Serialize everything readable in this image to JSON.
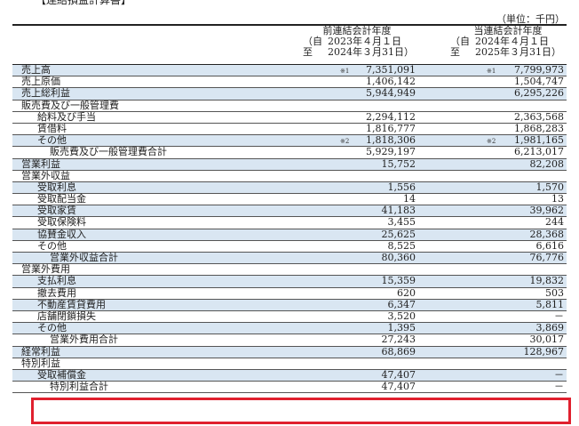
{
  "doc_title": "【連結損益計算書】",
  "unit": "（単位：千円）",
  "columns": {
    "prev": {
      "title": "前連結会計年度",
      "from_k": "（自",
      "from": "2023年４月１日",
      "to_k": "至",
      "to": "2024年３月31日）"
    },
    "cur": {
      "title": "当連結会計年度",
      "from_k": "（自",
      "from": "2024年４月１日",
      "to_k": "至",
      "to": "2025年３月31日）"
    }
  },
  "rows": [
    {
      "label": "売上高",
      "indent": 0,
      "shade": true,
      "note_prev": "※1",
      "prev": "7,351,091",
      "note_cur": "※1",
      "cur": "7,799,973"
    },
    {
      "label": "売上原価",
      "indent": 0,
      "shade": false,
      "note_prev": "",
      "prev": "1,406,142",
      "note_cur": "",
      "cur": "1,504,747"
    },
    {
      "label": "売上総利益",
      "indent": 0,
      "shade": true,
      "note_prev": "",
      "prev": "5,944,949",
      "note_cur": "",
      "cur": "6,295,226"
    },
    {
      "label": "販売費及び一般管理費",
      "indent": 0,
      "shade": false,
      "note_prev": "",
      "prev": "",
      "note_cur": "",
      "cur": ""
    },
    {
      "label": "給料及び手当",
      "indent": 1,
      "shade": false,
      "note_prev": "",
      "prev": "2,294,112",
      "note_cur": "",
      "cur": "2,363,568"
    },
    {
      "label": "賃借料",
      "indent": 1,
      "shade": false,
      "note_prev": "",
      "prev": "1,816,777",
      "note_cur": "",
      "cur": "1,868,283"
    },
    {
      "label": "その他",
      "indent": 1,
      "shade": true,
      "note_prev": "※2",
      "prev": "1,818,306",
      "note_cur": "※2",
      "cur": "1,981,165"
    },
    {
      "label": "販売費及び一般管理費合計",
      "indent": 2,
      "shade": false,
      "note_prev": "",
      "prev": "5,929,197",
      "note_cur": "",
      "cur": "6,213,017"
    },
    {
      "label": "営業利益",
      "indent": 0,
      "shade": true,
      "note_prev": "",
      "prev": "15,752",
      "note_cur": "",
      "cur": "82,208"
    },
    {
      "label": "営業外収益",
      "indent": 0,
      "shade": false,
      "note_prev": "",
      "prev": "",
      "note_cur": "",
      "cur": ""
    },
    {
      "label": "受取利息",
      "indent": 1,
      "shade": true,
      "note_prev": "",
      "prev": "1,556",
      "note_cur": "",
      "cur": "1,570"
    },
    {
      "label": "受取配当金",
      "indent": 1,
      "shade": false,
      "note_prev": "",
      "prev": "14",
      "note_cur": "",
      "cur": "13"
    },
    {
      "label": "受取家賃",
      "indent": 1,
      "shade": true,
      "note_prev": "",
      "prev": "41,183",
      "note_cur": "",
      "cur": "39,962"
    },
    {
      "label": "受取保険料",
      "indent": 1,
      "shade": false,
      "note_prev": "",
      "prev": "3,455",
      "note_cur": "",
      "cur": "244"
    },
    {
      "label": "協賛金収入",
      "indent": 1,
      "shade": true,
      "note_prev": "",
      "prev": "25,625",
      "note_cur": "",
      "cur": "28,368"
    },
    {
      "label": "その他",
      "indent": 1,
      "shade": false,
      "note_prev": "",
      "prev": "8,525",
      "note_cur": "",
      "cur": "6,616"
    },
    {
      "label": "営業外収益合計",
      "indent": 2,
      "shade": true,
      "note_prev": "",
      "prev": "80,360",
      "note_cur": "",
      "cur": "76,776"
    },
    {
      "label": "営業外費用",
      "indent": 0,
      "shade": false,
      "note_prev": "",
      "prev": "",
      "note_cur": "",
      "cur": ""
    },
    {
      "label": "支払利息",
      "indent": 1,
      "shade": true,
      "note_prev": "",
      "prev": "15,359",
      "note_cur": "",
      "cur": "19,832"
    },
    {
      "label": "撤去費用",
      "indent": 1,
      "shade": false,
      "note_prev": "",
      "prev": "620",
      "note_cur": "",
      "cur": "503"
    },
    {
      "label": "不動産賃貸費用",
      "indent": 1,
      "shade": true,
      "note_prev": "",
      "prev": "6,347",
      "note_cur": "",
      "cur": "5,811"
    },
    {
      "label": "店舗閉鎖損失",
      "indent": 1,
      "shade": false,
      "note_prev": "",
      "prev": "3,520",
      "note_cur": "",
      "cur": "－"
    },
    {
      "label": "その他",
      "indent": 1,
      "shade": true,
      "note_prev": "",
      "prev": "1,395",
      "note_cur": "",
      "cur": "3,869"
    },
    {
      "label": "営業外費用合計",
      "indent": 2,
      "shade": false,
      "note_prev": "",
      "prev": "27,243",
      "note_cur": "",
      "cur": "30,017"
    },
    {
      "label": "経常利益",
      "indent": 0,
      "shade": true,
      "note_prev": "",
      "prev": "68,869",
      "note_cur": "",
      "cur": "128,967"
    },
    {
      "label": "特別利益",
      "indent": 0,
      "shade": false,
      "note_prev": "",
      "prev": "",
      "note_cur": "",
      "cur": ""
    },
    {
      "label": "受取補償金",
      "indent": 1,
      "shade": true,
      "note_prev": "",
      "prev": "47,407",
      "note_cur": "",
      "cur": "－"
    },
    {
      "label": "特別利益合計",
      "indent": 2,
      "shade": false,
      "note_prev": "",
      "prev": "47,407",
      "note_cur": "",
      "cur": "－"
    }
  ]
}
